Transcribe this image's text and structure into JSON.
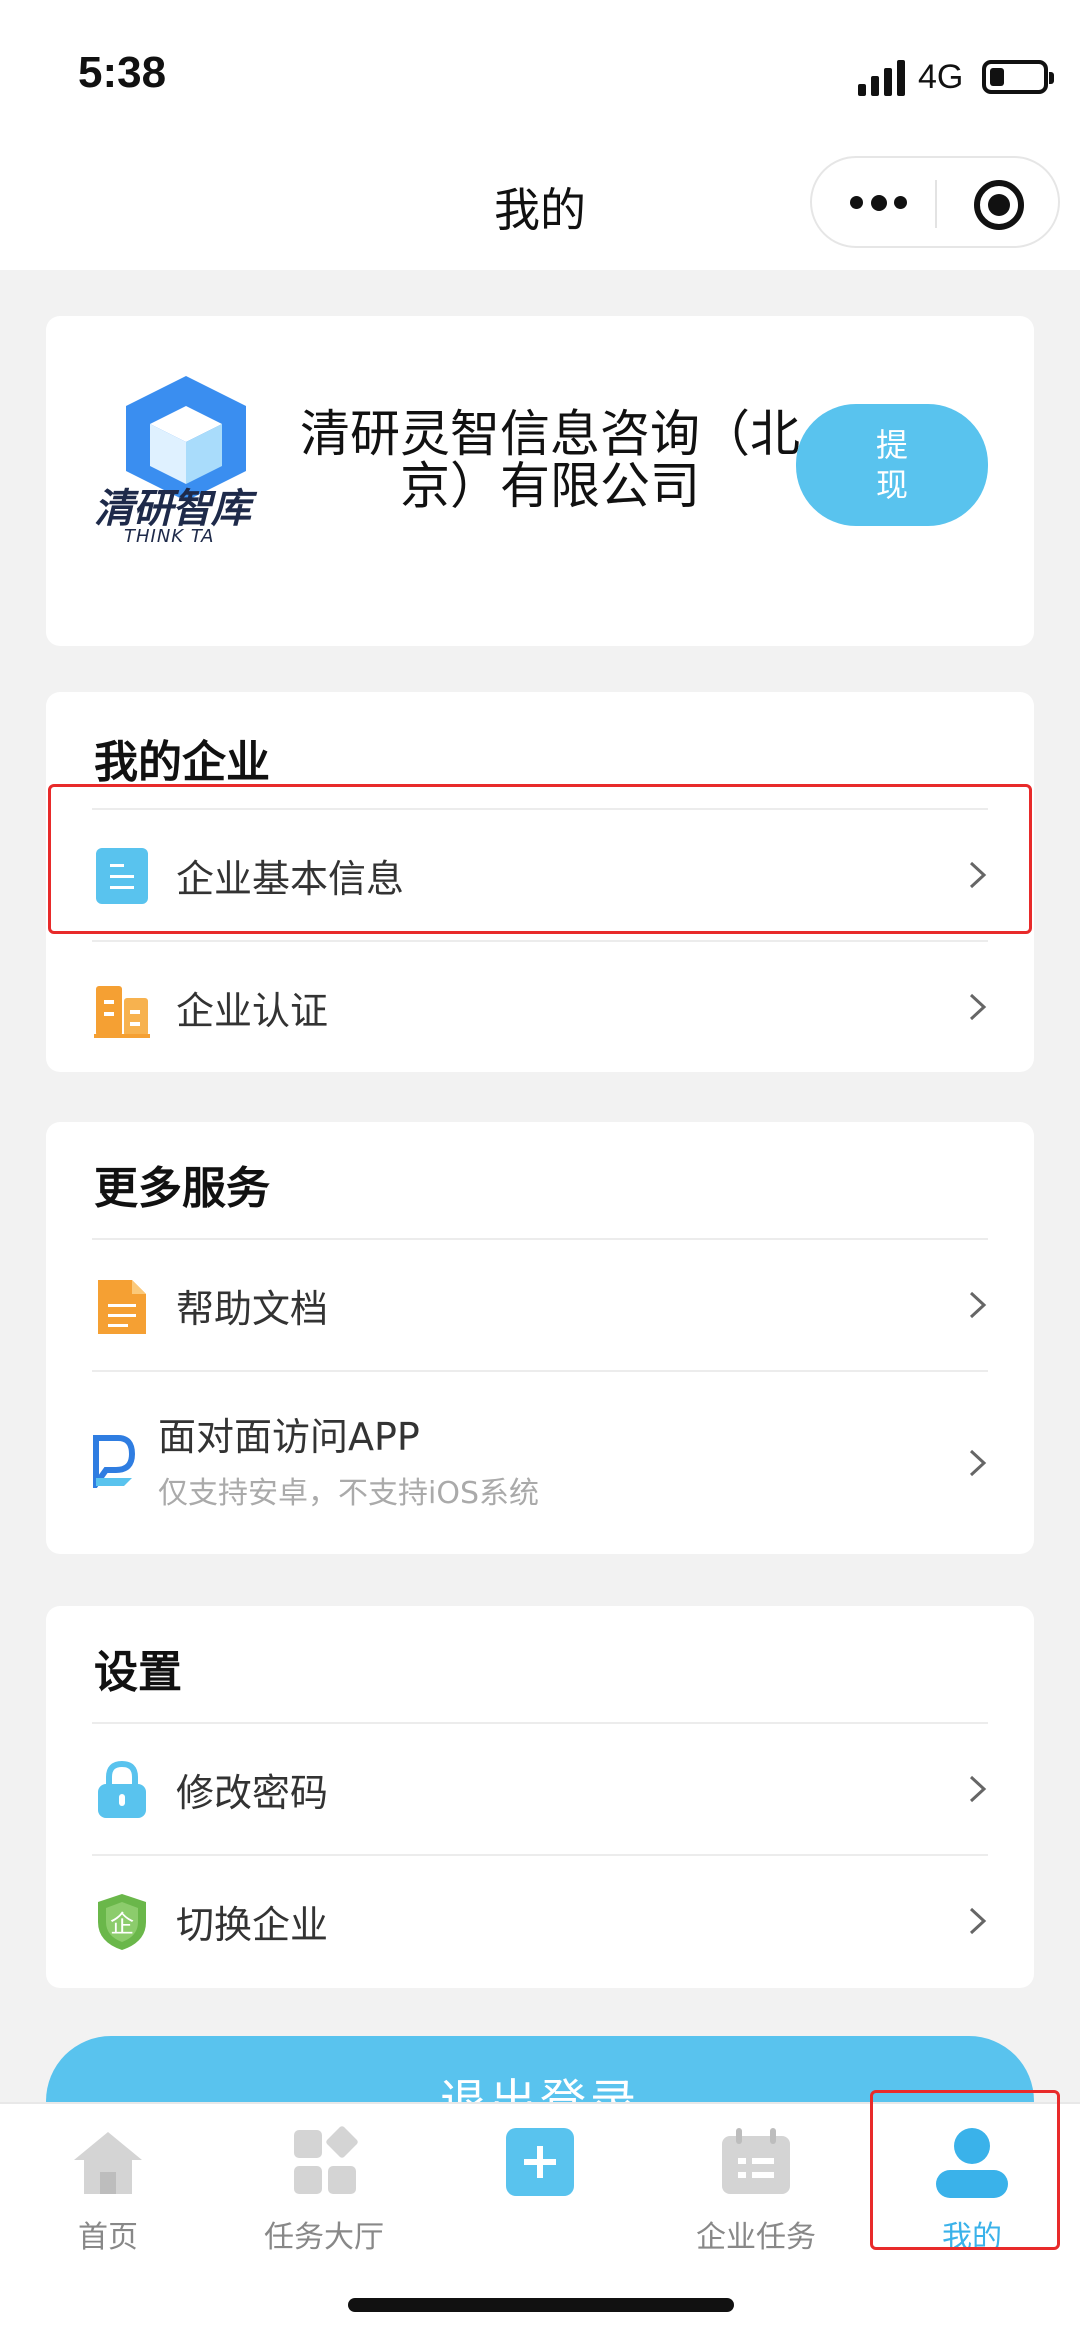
{
  "status_bar": {
    "time": "5:38",
    "network": "4G"
  },
  "nav": {
    "title": "我的"
  },
  "profile": {
    "logo_text": "清研智库",
    "logo_subtext": "THINK TA",
    "company_name": "清研灵智信息咨询（北京）有限公司",
    "withdraw_label": "提现"
  },
  "my_company": {
    "title": "我的企业",
    "items": [
      {
        "label": "企业基本信息",
        "icon": "document-list-icon"
      },
      {
        "label": "企业认证",
        "icon": "building-icon"
      }
    ]
  },
  "more_services": {
    "title": "更多服务",
    "items": [
      {
        "label": "帮助文档",
        "icon": "file-icon"
      },
      {
        "label": "面对面访问APP",
        "sublabel": "仅支持安卓，不支持iOS系统",
        "icon": "app-logo-icon"
      }
    ]
  },
  "settings": {
    "title": "设置",
    "items": [
      {
        "label": "修改密码",
        "icon": "lock-icon"
      },
      {
        "label": "切换企业",
        "icon": "shield-icon"
      }
    ]
  },
  "logout_label": "退出登录",
  "tab_bar": {
    "tabs": [
      {
        "label": "首页",
        "icon": "home-icon"
      },
      {
        "label": "任务大厅",
        "icon": "grid-icon"
      },
      {
        "label": "",
        "icon": "plus-icon"
      },
      {
        "label": "企业任务",
        "icon": "calendar-icon"
      },
      {
        "label": "我的",
        "icon": "user-icon",
        "active": true
      }
    ]
  },
  "colors": {
    "accent": "#59c3ee",
    "active_tab": "#3ab2ea",
    "highlight": "#e82a2a",
    "orange_icon": "#f5a033",
    "green_icon": "#6ab74a"
  }
}
